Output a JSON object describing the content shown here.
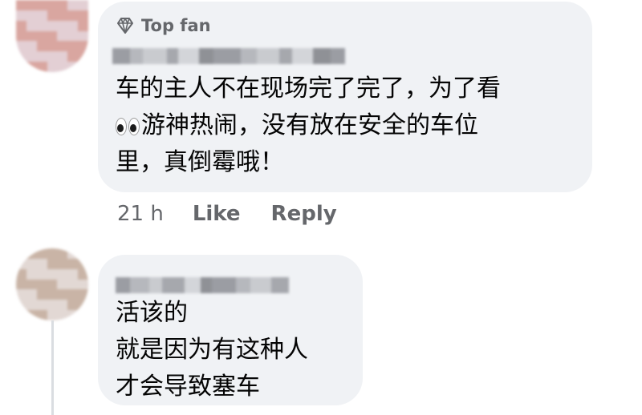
{
  "comments": [
    {
      "badge": "Top fan",
      "badge_icon": "diamond-icon",
      "text_line_1": "车的主人不在现场完了完了，为了看",
      "text_line_2": "游神热闹，没有放在安全的车位",
      "text_line_3": "里，真倒霉哦！",
      "inline_emoji": "eyes-emoji",
      "time": "21 h",
      "like_label": "Like",
      "reply_label": "Reply"
    },
    {
      "text_line_1": "活该的",
      "text_line_2": "就是因为有这种人",
      "text_line_3": "才会导致塞车"
    }
  ],
  "colors": {
    "bubble_bg": "#f0f2f5",
    "secondary_text": "#65676b",
    "primary_text": "#050505"
  }
}
